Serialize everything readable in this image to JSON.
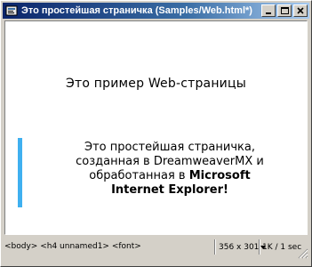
{
  "window": {
    "title": "Это простейшая страничка (Samples/Web.html*)"
  },
  "document": {
    "heading": "Это пример Web-страницы",
    "paragraph_line1": "Это простейшая страничка,",
    "paragraph_line2": "созданная в DreamweaverMX и",
    "paragraph_line3_prefix": "обработанная в ",
    "paragraph_line3_bold": "Microsoft",
    "paragraph_line4": "Internet Explorer!"
  },
  "statusbar": {
    "tags": [
      "<body>",
      "<h4 unnamed1>",
      "<font>"
    ],
    "window_size": "356 x 301",
    "download": "1K / 1 sec"
  },
  "colors": {
    "titlebar_start": "#0a246a",
    "selection_bar": "#3fb0f0",
    "chrome": "#d4d0c8"
  },
  "icons": [
    "dreamweaver-doc-icon",
    "minimize-icon",
    "maximize-icon",
    "close-icon",
    "resize-grip-icon"
  ]
}
